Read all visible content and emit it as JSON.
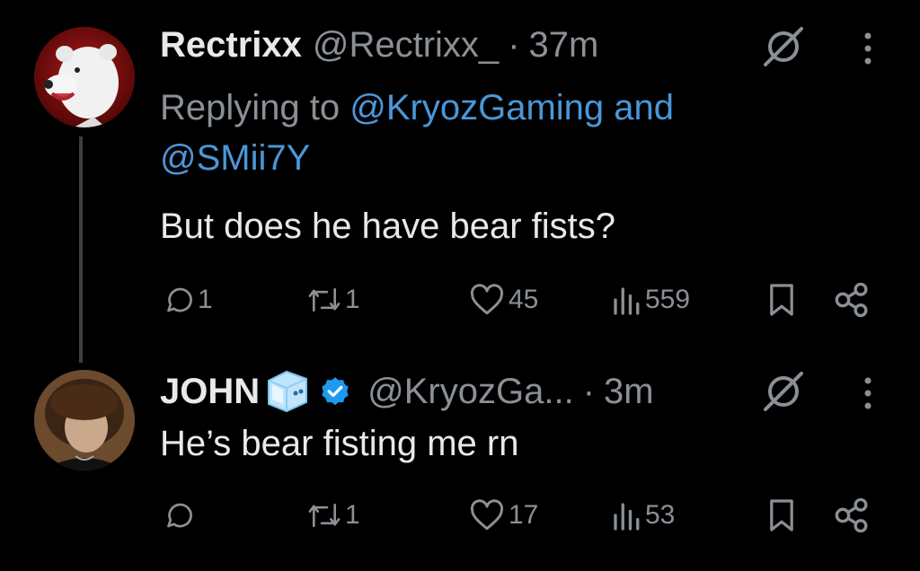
{
  "colors": {
    "background": "#000000",
    "text": "#e7e9ea",
    "muted": "#8b9096",
    "link": "#4a97d8",
    "verified": "#1d9bf0"
  },
  "tweets": [
    {
      "display_name": "Rectrixx",
      "handle": "@Rectrixx_",
      "separator": "·",
      "time": "37m",
      "replying_prefix": "Replying to",
      "replying_user_1": "@KryozGaming",
      "replying_joiner": "and",
      "replying_user_2": "@SMii7Y",
      "text": "But does he have bear fists?",
      "actions": {
        "replies": "1",
        "retweets": "1",
        "likes": "45",
        "views": "559"
      },
      "icons": [
        "grok-icon",
        "more-icon",
        "reply-icon",
        "retweet-icon",
        "like-icon",
        "views-icon",
        "bookmark-icon",
        "share-icon"
      ]
    },
    {
      "display_name": "JOHN",
      "handle": "@KryozGa...",
      "separator": "·",
      "time": "3m",
      "text": "He’s bear fisting me rn",
      "actions": {
        "replies": "",
        "retweets": "1",
        "likes": "17",
        "views": "53"
      },
      "badges": [
        "ice-cube-icon",
        "verified-badge-icon"
      ]
    }
  ]
}
